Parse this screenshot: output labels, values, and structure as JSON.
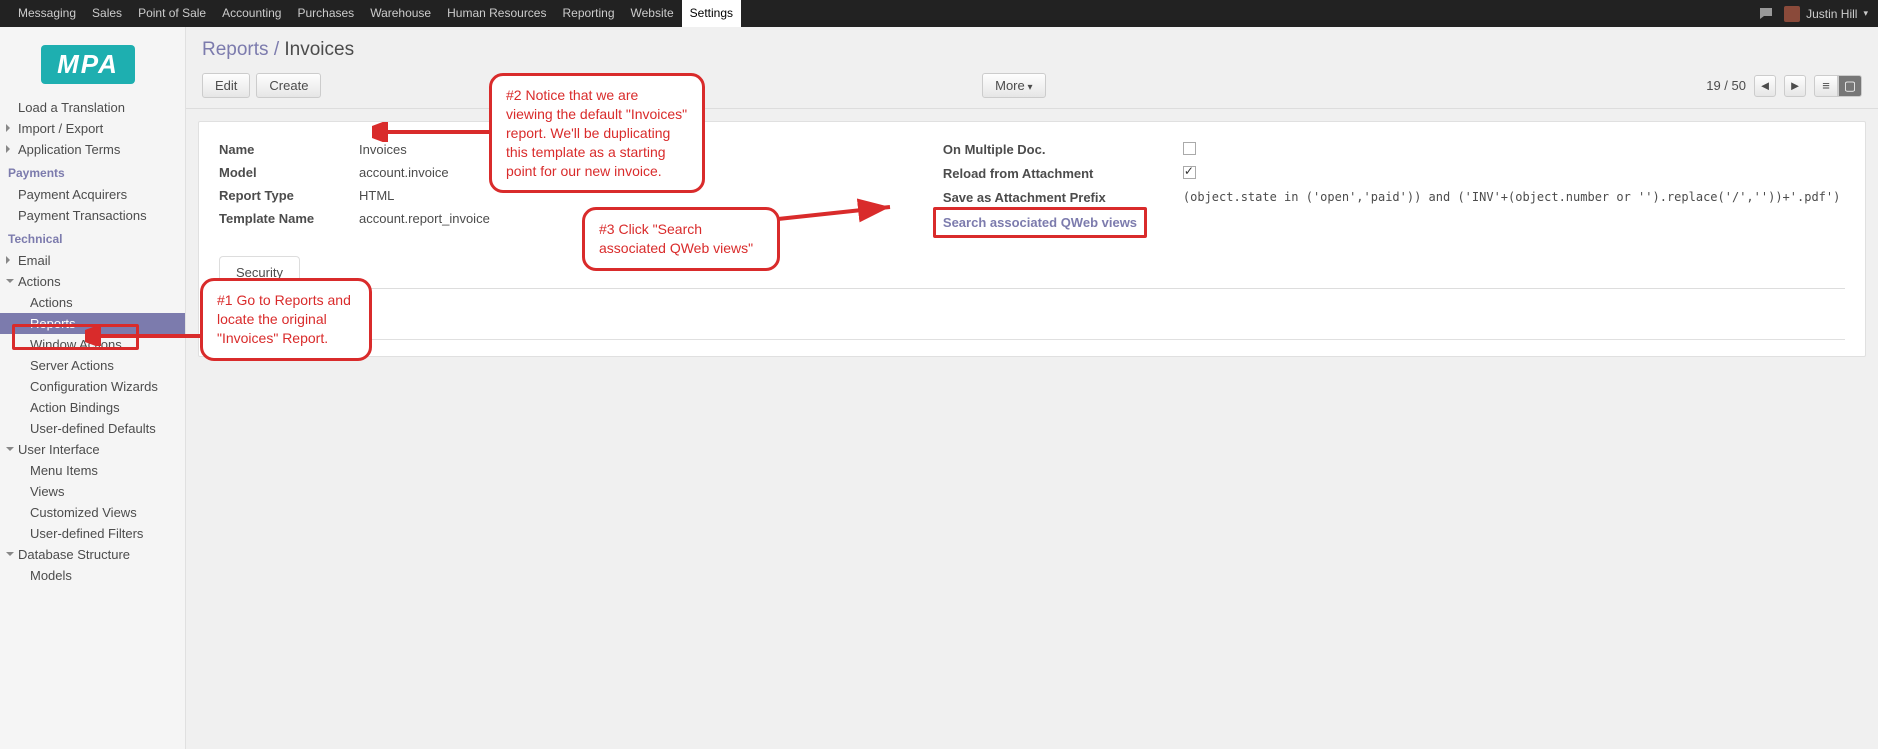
{
  "topnav": {
    "items": [
      "Messaging",
      "Sales",
      "Point of Sale",
      "Accounting",
      "Purchases",
      "Warehouse",
      "Human Resources",
      "Reporting",
      "Website",
      "Settings"
    ],
    "active_index": 9,
    "user_name": "Justin Hill"
  },
  "breadcrumb": {
    "parent": "Reports",
    "sep": "/",
    "current": "Invoices"
  },
  "toolbar": {
    "edit": "Edit",
    "create": "Create",
    "more": "More",
    "pager": "19 / 50"
  },
  "sidebar": {
    "items": [
      {
        "label": "Load a Translation",
        "depth": 1
      },
      {
        "label": "Import / Export",
        "depth": 1,
        "caret": "right"
      },
      {
        "label": "Application Terms",
        "depth": 1,
        "caret": "right"
      }
    ],
    "payments_heading": "Payments",
    "payments": [
      {
        "label": "Payment Acquirers"
      },
      {
        "label": "Payment Transactions"
      }
    ],
    "technical_heading": "Technical",
    "technical": [
      {
        "label": "Email",
        "caret": "right"
      },
      {
        "label": "Actions",
        "caret": "open"
      },
      {
        "label": "Actions",
        "depth2": true
      },
      {
        "label": "Reports",
        "depth2": true,
        "active": true
      },
      {
        "label": "Window Actions",
        "depth2": true
      },
      {
        "label": "Server Actions",
        "depth2": true
      },
      {
        "label": "Configuration Wizards",
        "depth2": true
      },
      {
        "label": "Action Bindings",
        "depth2": true
      },
      {
        "label": "User-defined Defaults",
        "depth2": true
      },
      {
        "label": "User Interface",
        "caret": "open"
      },
      {
        "label": "Menu Items",
        "depth2": true
      },
      {
        "label": "Views",
        "depth2": true
      },
      {
        "label": "Customized Views",
        "depth2": true
      },
      {
        "label": "User-defined Filters",
        "depth2": true
      },
      {
        "label": "Database Structure",
        "caret": "open"
      },
      {
        "label": "Models",
        "depth2": true
      }
    ]
  },
  "form": {
    "left": {
      "name_label": "Name",
      "name_value": "Invoices",
      "model_label": "Model",
      "model_value": "account.invoice",
      "report_type_label": "Report Type",
      "report_type_value": "HTML",
      "template_label": "Template Name",
      "template_value": "account.report_invoice"
    },
    "right": {
      "multiple_doc_label": "On Multiple Doc.",
      "multiple_doc_checked": false,
      "reload_label": "Reload from Attachment",
      "reload_checked": true,
      "prefix_label": "Save as Attachment Prefix",
      "prefix_value": "(object.state in ('open','paid')) and ('INV'+(object.number or '').replace('/',''))+'.pdf')",
      "qweb_link": "Search associated QWeb views"
    }
  },
  "tabs": {
    "security": "Security"
  },
  "annotations": {
    "a1": "#1 Go to Reports and locate the original \"Invoices\" Report.",
    "a2": "#2 Notice that we are viewing the default \"Invoices\" report. We'll be duplicating this template as a starting point for our new invoice.",
    "a3": "#3 Click \"Search associated QWeb views\""
  }
}
